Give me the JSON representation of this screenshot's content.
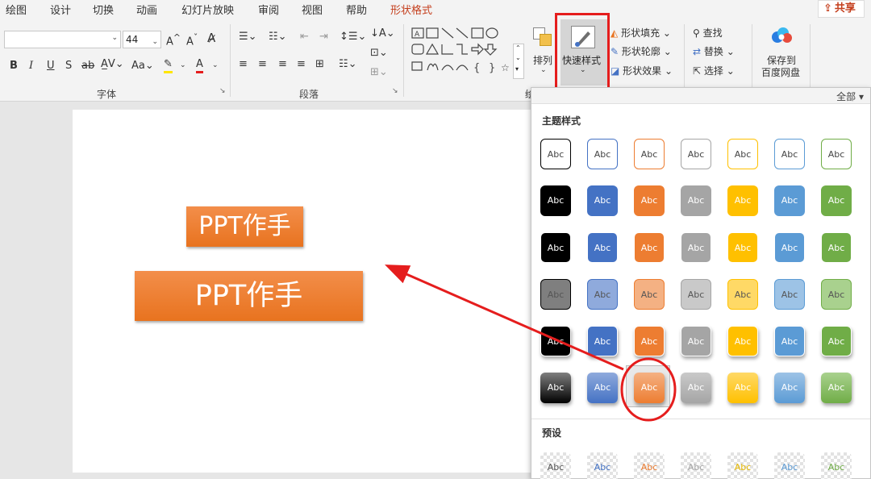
{
  "tabs": [
    {
      "label": "绘图",
      "active": false
    },
    {
      "label": "设计",
      "active": false
    },
    {
      "label": "切换",
      "active": false
    },
    {
      "label": "动画",
      "active": false
    },
    {
      "label": "幻灯片放映",
      "active": false
    },
    {
      "label": "审阅",
      "active": false
    },
    {
      "label": "视图",
      "active": false
    },
    {
      "label": "帮助",
      "active": false
    },
    {
      "label": "形状格式",
      "active": true
    }
  ],
  "share_label": "共享",
  "font": {
    "name_value": "",
    "size_value": "44",
    "group_label": "字体"
  },
  "paragraph": {
    "group_label": "段落"
  },
  "drawing": {
    "group_label": "绘",
    "arrange_label": "排列",
    "quick_styles_label": "快速样式",
    "shape_fill": "形状填充",
    "shape_outline": "形状轮廓",
    "shape_effects": "形状效果"
  },
  "editing": {
    "find": "查找",
    "replace": "替换",
    "select": "选择"
  },
  "baidu": {
    "line1": "保存到",
    "line2": "百度网盘"
  },
  "gallery": {
    "filter_label": "全部",
    "theme_section": "主题样式",
    "preset_section": "预设",
    "swatch_text": "Abc"
  },
  "slide": {
    "shape1_text": "PPT作手",
    "shape2_text": "PPT作手"
  },
  "colors": {
    "highlight": "#e51d1d",
    "accent": "#c43e1c",
    "orange": "#ed7d31",
    "blue": "#4472c4",
    "gray": "#a5a5a5",
    "gold": "#ffc000",
    "lightblue": "#5b9bd5",
    "green": "#70ad47",
    "black": "#000000"
  }
}
